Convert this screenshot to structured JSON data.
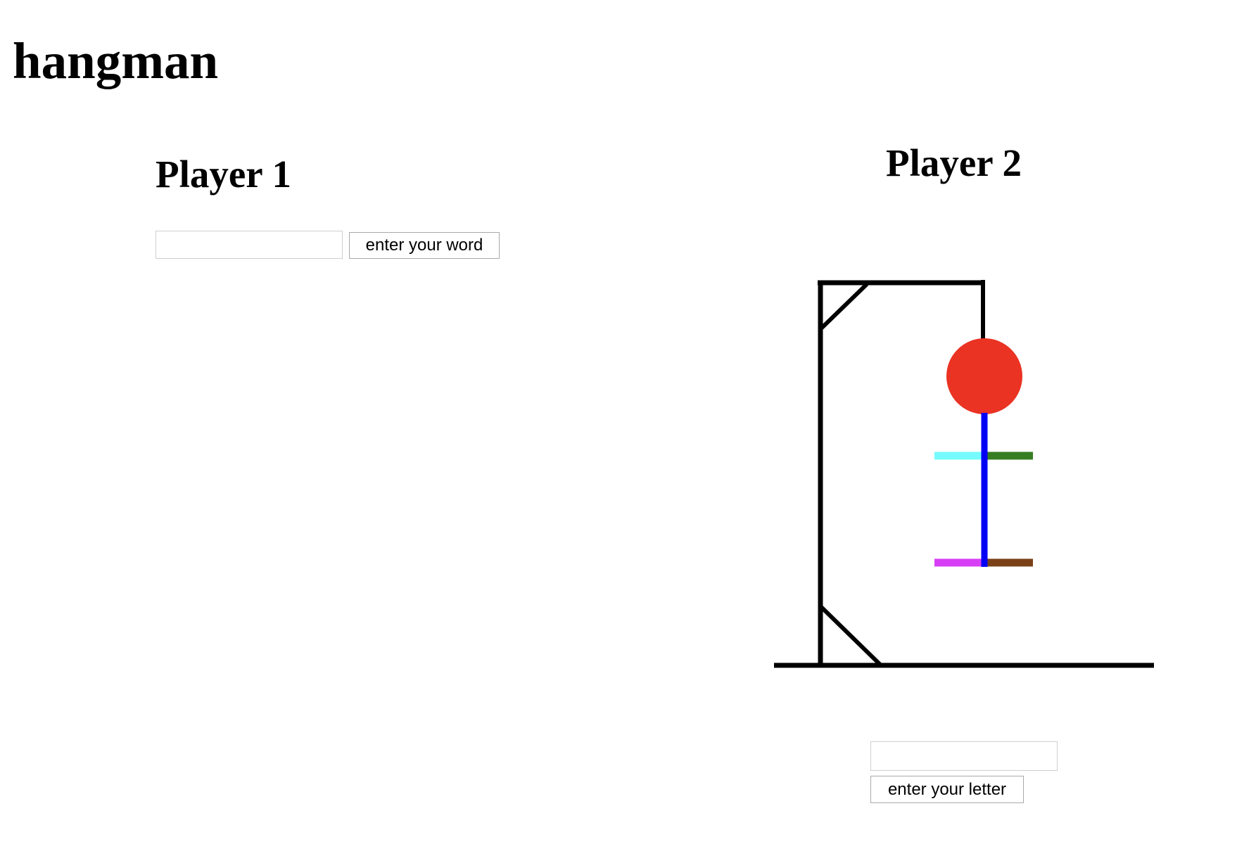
{
  "page": {
    "title": "hangman"
  },
  "player1": {
    "heading": "Player 1",
    "word_input": {
      "value": "",
      "placeholder": ""
    },
    "submit_label": "enter your word"
  },
  "player2": {
    "heading": "Player 2",
    "letter_input": {
      "value": "",
      "placeholder": ""
    },
    "submit_label": "enter your letter"
  },
  "drawing": {
    "icon": "hangman-drawing",
    "parts_shown": [
      "gallows",
      "head",
      "body",
      "left-arm",
      "right-arm",
      "left-leg",
      "right-leg"
    ],
    "colors": {
      "gallows": "#000000",
      "head": "#ea3323",
      "body": "#0000f5",
      "left_arm": "#75fbfd",
      "right_arm": "#377d22",
      "left_leg": "#d63ff5",
      "right_leg": "#7a4119"
    }
  }
}
